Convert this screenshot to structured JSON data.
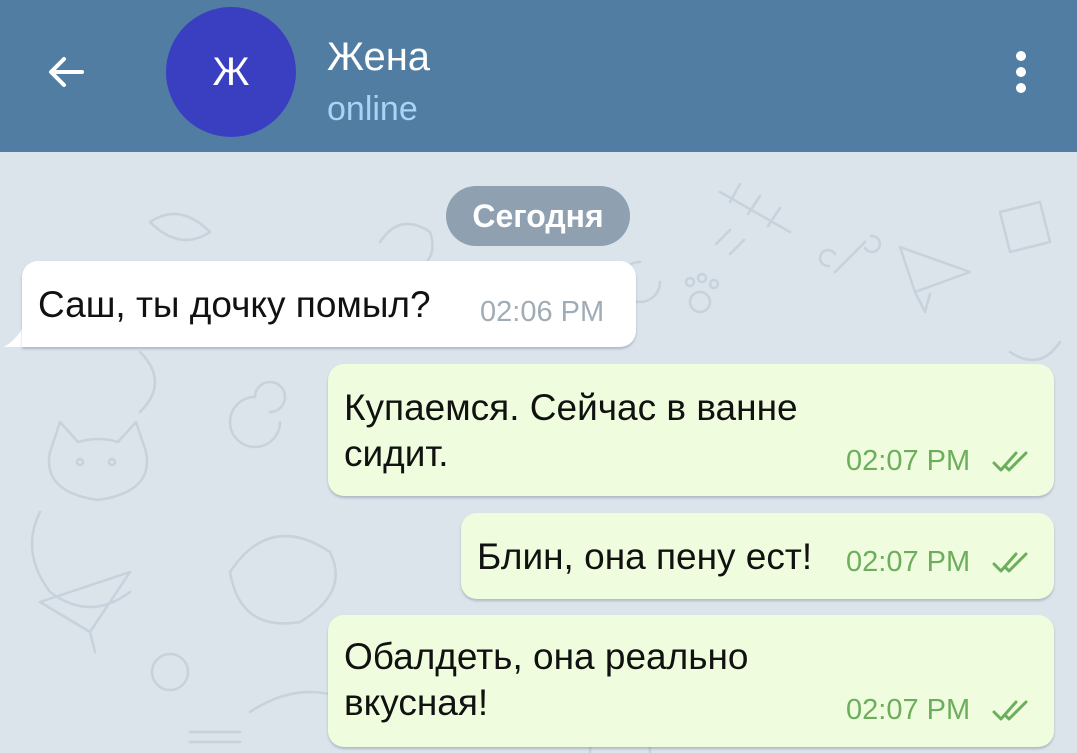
{
  "header": {
    "back_icon": "arrow-left-icon",
    "avatar_letter": "Ж",
    "avatar_color": "#3a3fc2",
    "title": "Жена",
    "status": "online",
    "menu_icon": "more-vertical-icon",
    "background_color": "#517da2"
  },
  "chat": {
    "date_label": "Сегодня",
    "messages": [
      {
        "direction": "incoming",
        "lines": [
          "Саш, ты дочку помыл?"
        ],
        "time": "02:06 PM"
      },
      {
        "direction": "outgoing",
        "lines": [
          "Купаемся. Сейчас в ванне",
          "сидит."
        ],
        "time": "02:07 PM",
        "status_icon": "double-check-icon"
      },
      {
        "direction": "outgoing",
        "lines": [
          "Блин, она пену ест!"
        ],
        "time": "02:07 PM",
        "status_icon": "double-check-icon"
      },
      {
        "direction": "outgoing",
        "lines": [
          "Обалдеть, она реально",
          "вкусная!"
        ],
        "time": "02:07 PM",
        "status_icon": "double-check-icon"
      }
    ]
  },
  "colors": {
    "incoming_bubble": "#ffffff",
    "outgoing_bubble": "#effdde",
    "outgoing_time": "#6dae5d",
    "incoming_time": "#a0acb6",
    "status_text": "#a9d4f5"
  }
}
